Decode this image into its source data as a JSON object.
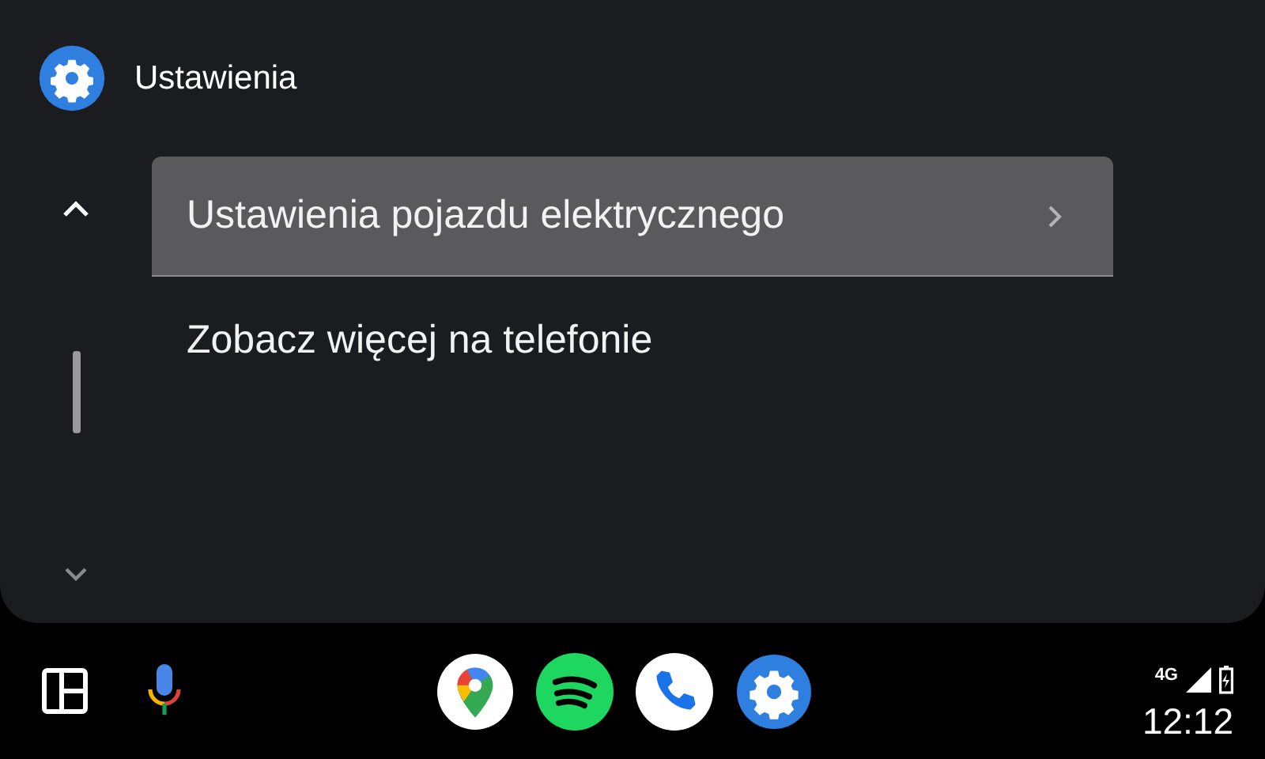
{
  "header": {
    "title": "Ustawienia"
  },
  "items": [
    {
      "label": "Ustawienia pojazdu elektrycznego",
      "selected": true,
      "kind": "submenu"
    },
    {
      "label": "Zobacz więcej na telefonie",
      "selected": false,
      "kind": "plain"
    }
  ],
  "status_bar": {
    "network": "4G",
    "time": "12:12"
  }
}
